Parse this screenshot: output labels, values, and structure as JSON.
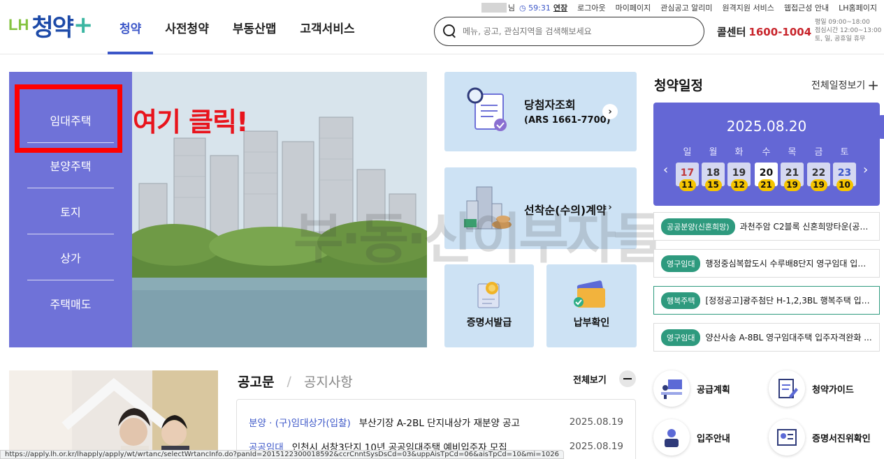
{
  "header": {
    "logo": {
      "prefix": "LH",
      "name": "청약",
      "suffix": "+"
    },
    "nav": [
      "청약",
      "사전청약",
      "부동산맵",
      "고객서비스"
    ],
    "utility": {
      "user_suffix": "님",
      "timer": "59:31",
      "extend": "연장",
      "links": [
        "로그아웃",
        "마이페이지",
        "관심공고 알리미",
        "원격지원 서비스",
        "웹접근성 안내",
        "LH홈페이지"
      ]
    },
    "search": {
      "placeholder": "메뉴, 공고, 관심지역을 검색해보세요"
    },
    "callcenter": {
      "label": "콜센터",
      "number": "1600-1004"
    },
    "hours": [
      "평일 09:00~18:00",
      "점심시간 12:00~13:00",
      "토, 일, 공휴일 휴무"
    ]
  },
  "side_menu": {
    "items": [
      "임대주택",
      "분양주택",
      "토지",
      "상가",
      "주택매도"
    ]
  },
  "annotation": {
    "text": "여기 클릭!",
    "color": "#ff0000"
  },
  "watermark": "부·동·산이부자들",
  "cards": {
    "winner": {
      "title": "당첨자조회",
      "sub": "(ARS 1661-7700)"
    },
    "first_come": {
      "title": "선착순(수의)계약"
    },
    "certificate": {
      "title": "증명서발급"
    },
    "payment": {
      "title": "납부확인"
    }
  },
  "schedule": {
    "title": "청약일정",
    "view_all": "전체일정보기",
    "date": "2025.08.20",
    "days": [
      {
        "dow": "일",
        "num": "17",
        "count": "11",
        "kind": "sun"
      },
      {
        "dow": "월",
        "num": "18",
        "count": "15",
        "kind": ""
      },
      {
        "dow": "화",
        "num": "19",
        "count": "12",
        "kind": ""
      },
      {
        "dow": "수",
        "num": "20",
        "count": "21",
        "kind": "today"
      },
      {
        "dow": "목",
        "num": "21",
        "count": "19",
        "kind": ""
      },
      {
        "dow": "금",
        "num": "22",
        "count": "19",
        "kind": ""
      },
      {
        "dow": "토",
        "num": "23",
        "count": "10",
        "kind": "sat"
      }
    ],
    "notices": [
      {
        "badge": "공공분양(신혼희망)",
        "text": "과천주암 C2블록 신혼희망타운(공공..."
      },
      {
        "badge": "영구임대",
        "text": "행정중심복합도시 수루배8단지 영구임대 입주..."
      },
      {
        "badge": "행복주택",
        "text": "[정정공고]광주첨단 H-1,2,3BL 행복주택 입주..."
      },
      {
        "badge": "영구임대",
        "text": "양산사송 A-8BL 영구임대주택 입주자격완화 ..."
      }
    ],
    "accent": "#6467d5",
    "badge_color": "#2e9a7e"
  },
  "board": {
    "tabs": [
      "공고문",
      "공지사항"
    ],
    "more": "전체보기",
    "rows": [
      {
        "category": "분양 · (구)임대상가(입찰)",
        "title": "부산기장 A-2BL 단지내상가 재분양 공고",
        "date": "2025.08.19"
      },
      {
        "category": "공공임대",
        "title": "인천시 서창3단지 10년 공공임대주택 예비입주자 모집",
        "date": "2025.08.19"
      }
    ]
  },
  "shortcuts": [
    "공급계획",
    "청약가이드",
    "입주안내",
    "증명서진위확인"
  ],
  "statusbar": "https://apply.lh.or.kr/lhapply/apply/wt/wrtanc/selectWrtancInfo.do?panId=2015122300018592&ccrCnntSysDsCd=03&uppAisTpCd=06&aisTpCd=10&mi=1026"
}
